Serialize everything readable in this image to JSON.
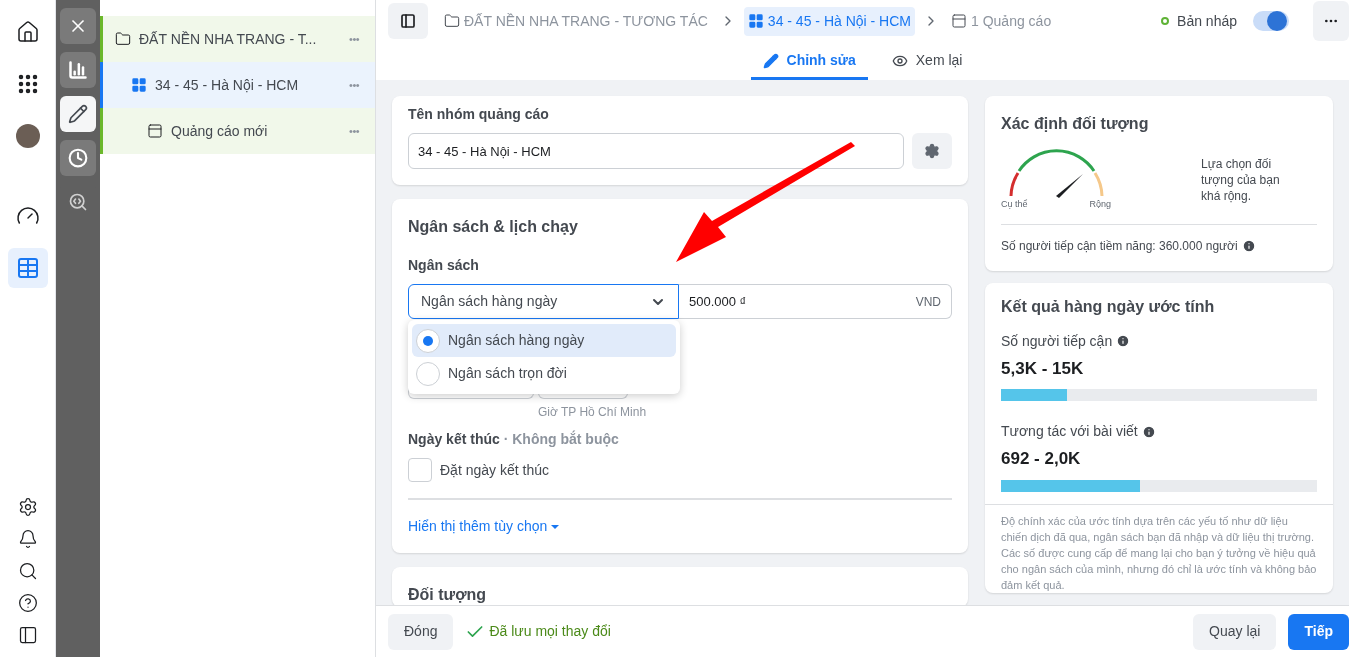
{
  "rail_items": [
    {
      "kind": "home",
      "selected": false
    },
    {
      "kind": "apps",
      "selected": false
    },
    {
      "kind": "avatar",
      "selected": false
    },
    {
      "kind": "gauge",
      "selected": false
    },
    {
      "kind": "table",
      "selected": true
    }
  ],
  "rail_bottom": [
    {
      "kind": "settings"
    },
    {
      "kind": "bell"
    },
    {
      "kind": "search"
    },
    {
      "kind": "help"
    },
    {
      "kind": "panel"
    }
  ],
  "tool_rail": [
    {
      "kind": "close",
      "selected": false
    },
    {
      "kind": "chart",
      "selected": false
    },
    {
      "kind": "edit",
      "selected": true
    },
    {
      "kind": "history",
      "selected": false
    },
    {
      "kind": "inspect",
      "selected": false
    }
  ],
  "tree": [
    {
      "kind": "campaign",
      "label": "ĐẤT NỀN NHA TRANG - T...",
      "selected": false,
      "more": "•••",
      "children": [
        {
          "kind": "adset",
          "label": "34 - 45 - Hà Nội - HCM",
          "selected": true,
          "more": "•••",
          "children": [
            {
              "kind": "ad",
              "label": "Quảng cáo mới",
              "selected": false,
              "more": "•••"
            }
          ]
        }
      ]
    }
  ],
  "breadcrumbs": [
    {
      "kind": "campaign",
      "label": "ĐẤT NỀN NHA TRANG - TƯƠNG TÁC",
      "selected": false
    },
    {
      "kind": "adset",
      "label": "34 - 45 - Hà Nội - HCM",
      "selected": true
    },
    {
      "kind": "ad",
      "label": "1 Quảng cáo",
      "selected": false
    }
  ],
  "status": {
    "label": "Bản nháp",
    "on": true
  },
  "tabs": [
    {
      "kind": "edit",
      "label": "Chỉnh sửa",
      "selected": true
    },
    {
      "kind": "preview",
      "label": "Xem lại",
      "selected": false
    }
  ],
  "adset_name": {
    "label": "Tên nhóm quảng cáo",
    "value": "34 - 45 - Hà Nội - HCM"
  },
  "budget": {
    "title": "Ngân sách & lịch chạy",
    "label": "Ngân sách",
    "type_value": "Ngân sách hàng ngày",
    "amount": "500.000 ₫",
    "currency": "VND",
    "options": [
      {
        "label": "Ngân sách hàng ngày",
        "selected": true
      },
      {
        "label": "Ngân sách trọn đời",
        "selected": false
      }
    ],
    "timezone": "Giờ TP Hồ Chí Minh",
    "end_label": "Ngày kết thúc",
    "end_optional": "· Không bắt buộc",
    "end_checkbox": {
      "label": "Đặt ngày kết thúc",
      "checked": false
    },
    "more_options": "Hiển thị thêm tùy chọn"
  },
  "audience_title": "Đối tượng",
  "audience_def": {
    "title": "Xác định đối tượng",
    "gauge_left": "Cụ thể",
    "gauge_right": "Rộng",
    "description": "Lựa chọn đối tượng của bạn khá rộng.",
    "reach": "Số người tiếp cận tiềm năng: 360.000 người"
  },
  "estimates": {
    "title": "Kết quả hàng ngày ước tính",
    "metrics": [
      {
        "label": "Số người tiếp cận",
        "value": "5,3K - 15K",
        "level": 0.21
      },
      {
        "label": "Tương tác với bài viết",
        "value": "692 - 2,0K",
        "level": 0.44
      }
    ],
    "note": "Độ chính xác của ước tính dựa trên các yếu tố như dữ liệu chiến dịch đã qua, ngân sách bạn đã nhập và dữ liệu thị trường. Các số được cung cấp để mang lại cho bạn ý tưởng về hiệu quả cho ngân sách của mình, nhưng đó chỉ là ước tính và không bảo đảm kết quả."
  },
  "footer": {
    "close": "Đóng",
    "saved": "Đã lưu mọi thay đổi",
    "back": "Quay lại",
    "next": "Tiếp"
  }
}
